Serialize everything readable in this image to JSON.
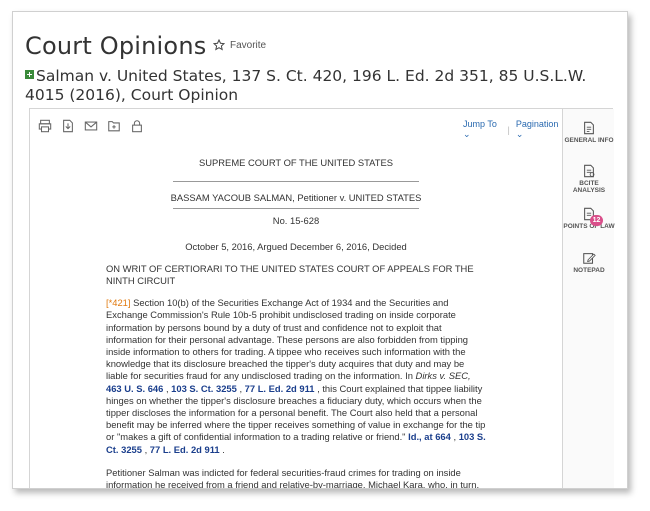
{
  "header": {
    "title": "Court Opinions",
    "favorite_label": "Favorite"
  },
  "case": {
    "title": "Salman v. United States, 137 S. Ct. 420, 196 L. Ed. 2d 351, 85 U.S.L.W. 4015 (2016), Court Opinion"
  },
  "toolbar": {
    "icons": [
      "print-icon",
      "download-icon",
      "email-icon",
      "save-to-folder-icon",
      "lock-icon"
    ],
    "jump_to": "Jump To",
    "pagination": "Pagination"
  },
  "rail": {
    "general_info": "GENERAL INFO",
    "bcite": "BCITE ANALYSIS",
    "points_of_law": "POINTS OF LAW",
    "points_count": "12",
    "notepad": "NOTEPAD"
  },
  "doc": {
    "court": "SUPREME COURT OF THE UNITED STATES",
    "parties": "BASSAM YACOUB SALMAN, Petitioner v. UNITED STATES",
    "number": "No. 15-628",
    "dates": "October 5, 2016, Argued December 6, 2016, Decided",
    "writ": "ON WRIT OF CERTIORARI TO THE UNITED STATES COURT OF APPEALS FOR THE NINTH CIRCUIT",
    "p1": {
      "star": "[*421]",
      "text1": " Section 10(b) of the Securities Exchange Act of 1934 and the Securities and Exchange Commission's Rule 10b-5 prohibit undisclosed trading on inside corporate information by persons bound by a duty of trust and confidence not to exploit that information for their personal advantage. These persons are also forbidden from tipping inside information to others for trading. A tippee who receives such information with the knowledge that its disclosure breached the tipper's duty acquires that duty and may be liable for securities fraud for any undisclosed trading on the information. In ",
      "case_ref": "Dirks v. SEC,",
      "cite1": "463 U. S. 646",
      "sep1": " , ",
      "cite2": "103 S. Ct. 3255",
      "sep2": " , ",
      "cite3": "77 L. Ed. 2d 911",
      "text2": " , this Court explained that tippee liability hinges on whether the tipper's disclosure breaches a fiduciary duty, which occurs when the tipper discloses the information for a personal benefit. The Court also held that a personal benefit may be inferred where the tipper receives something of value in exchange for the tip or \"makes a gift of confidential information to a trading relative or friend.\" ",
      "cite4": "Id., at 664",
      "sep3": " , ",
      "cite5": "103 S. Ct. 3255",
      "sep4": " , ",
      "cite6": "77 L. Ed. 2d 911",
      "end": " ."
    },
    "p2": "Petitioner Salman was indicted for federal securities-fraud crimes for trading on inside information he received from a friend and relative-by-marriage, Michael Kara, who, in turn, received the information from his brother, Maher Kara, a former investment banker at Citigroup. Maher testified at Salman's trial that he shared inside information with his"
  }
}
